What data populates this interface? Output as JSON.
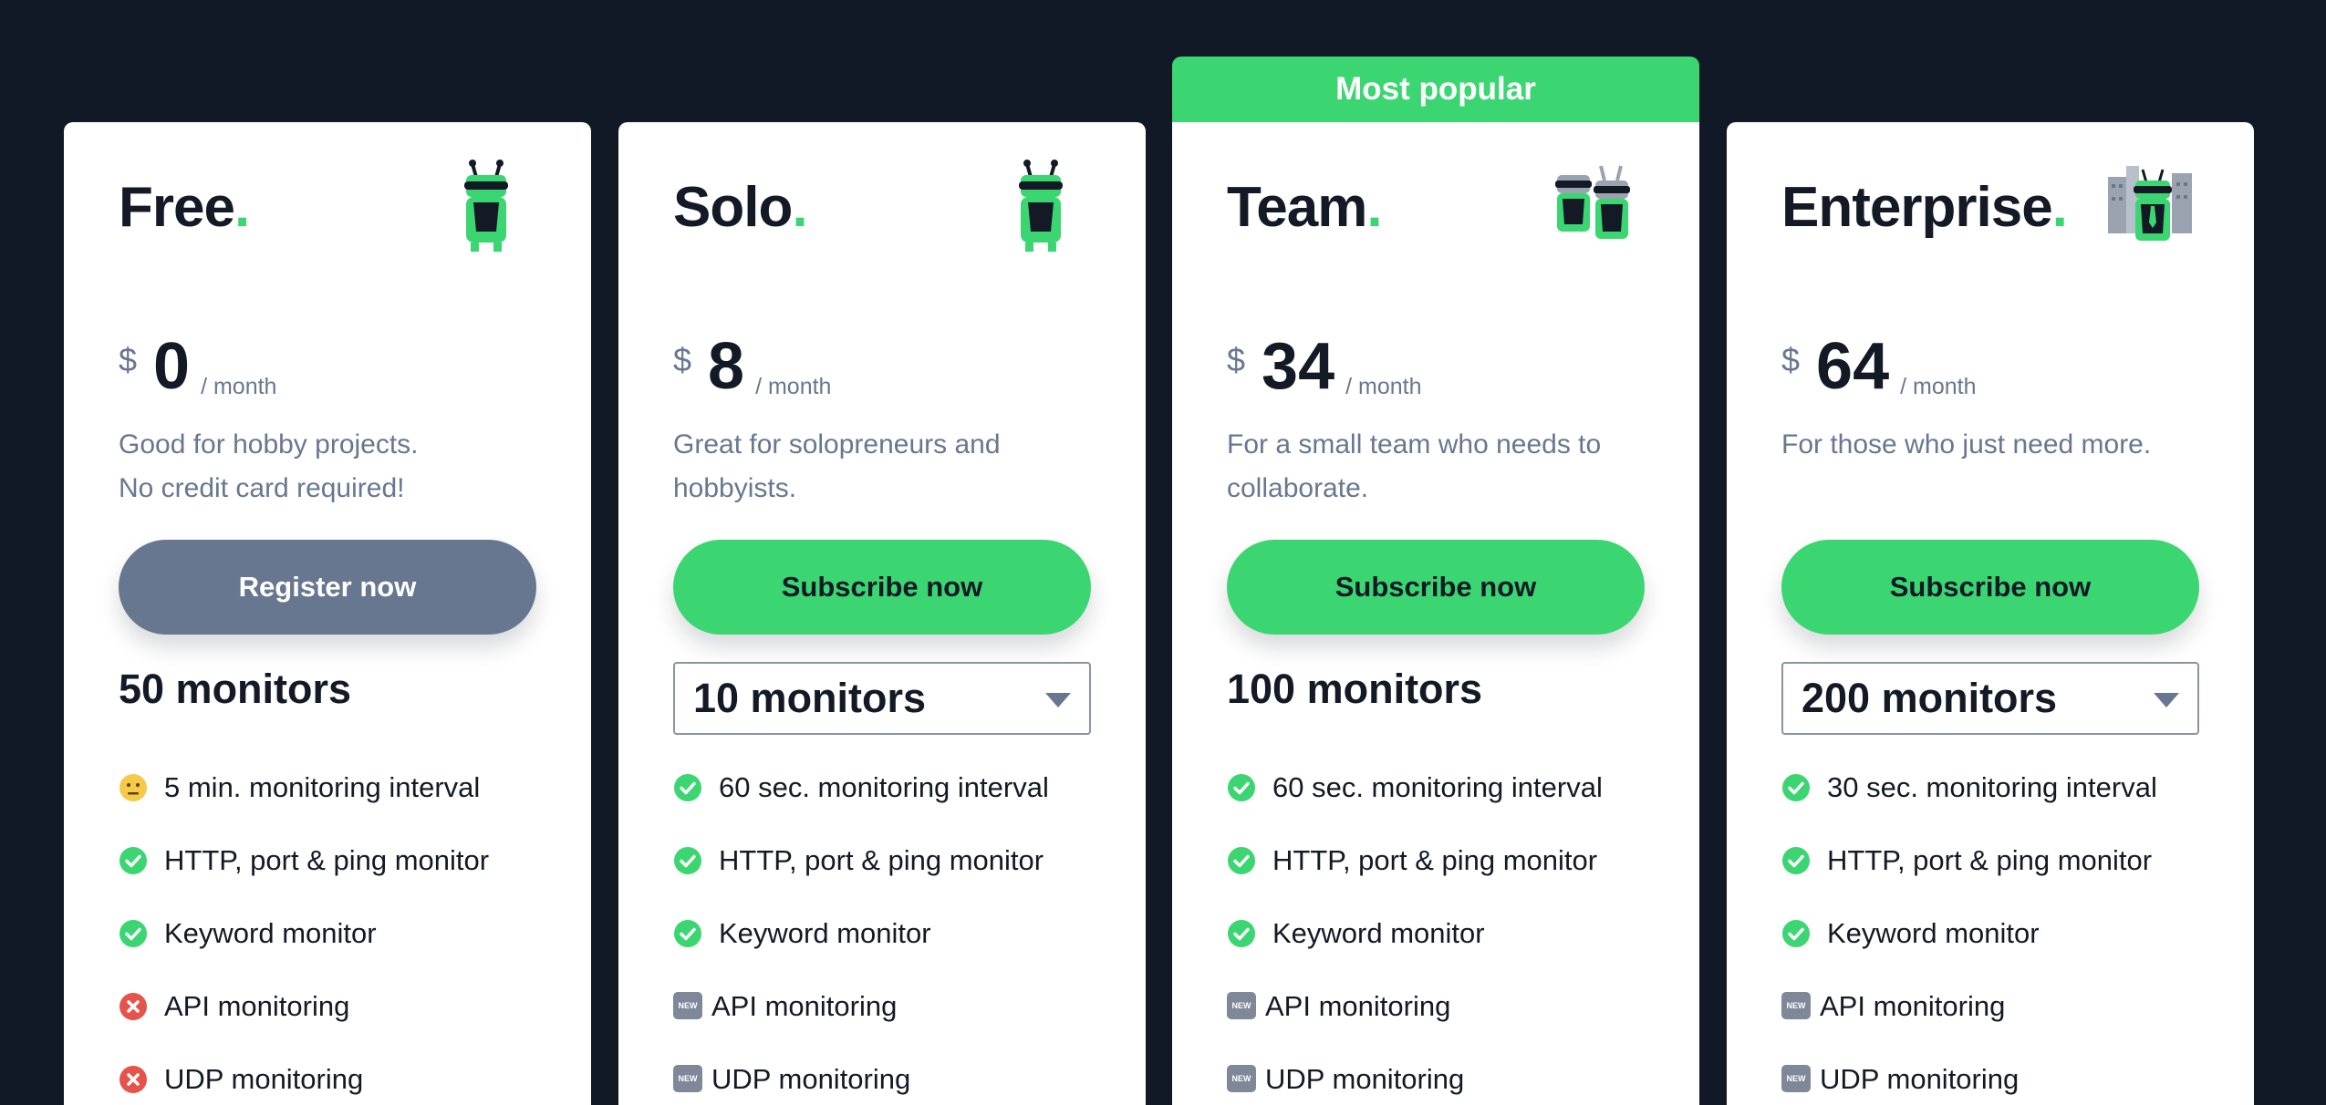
{
  "colors": {
    "background": "#121926",
    "card": "#ffffff",
    "accent_green": "#3bd671",
    "muted_grey": "#687790",
    "text_dark": "#131a26",
    "error_red": "#e5534b"
  },
  "banner": {
    "label": "Most popular"
  },
  "plans": [
    {
      "name": "Free",
      "dot": ".",
      "currency": "$",
      "price": "0",
      "period": "/ month",
      "description_lines": [
        "Good for hobby projects.",
        "No credit card required!"
      ],
      "cta_label": "Register now",
      "monitors_label": "50 monitors",
      "features": [
        {
          "icon": "neutral-face-icon",
          "text": "5 min. monitoring interval"
        },
        {
          "icon": "check-icon",
          "text": "HTTP, port & ping monitor"
        },
        {
          "icon": "check-icon",
          "text": "Keyword monitor"
        },
        {
          "icon": "cross-icon",
          "text": "API monitoring"
        },
        {
          "icon": "cross-icon",
          "text": "UDP monitoring"
        }
      ]
    },
    {
      "name": "Solo",
      "dot": ".",
      "currency": "$",
      "price": "8",
      "period": "/ month",
      "description_lines": [
        "Great for solopreneurs and",
        "hobbyists."
      ],
      "cta_label": "Subscribe now",
      "monitors_label": "10 monitors",
      "features": [
        {
          "icon": "check-icon",
          "text": "60 sec. monitoring interval"
        },
        {
          "icon": "check-icon",
          "text": "HTTP, port & ping monitor"
        },
        {
          "icon": "check-icon",
          "text": "Keyword monitor"
        },
        {
          "icon": "new-badge-icon",
          "text": "API monitoring"
        },
        {
          "icon": "new-badge-icon",
          "text": "UDP monitoring"
        }
      ]
    },
    {
      "name": "Team",
      "dot": ".",
      "currency": "$",
      "price": "34",
      "period": "/ month",
      "description_lines": [
        "For a small team who needs to",
        "collaborate."
      ],
      "cta_label": "Subscribe now",
      "monitors_label": "100 monitors",
      "features": [
        {
          "icon": "check-icon",
          "text": "60 sec. monitoring interval"
        },
        {
          "icon": "check-icon",
          "text": "HTTP, port & ping monitor"
        },
        {
          "icon": "check-icon",
          "text": "Keyword monitor"
        },
        {
          "icon": "new-badge-icon",
          "text": "API monitoring"
        },
        {
          "icon": "new-badge-icon",
          "text": "UDP monitoring"
        }
      ]
    },
    {
      "name": "Enterprise",
      "dot": ".",
      "currency": "$",
      "price": "64",
      "period": "/ month",
      "description_lines": [
        "For those who just need more."
      ],
      "cta_label": "Subscribe now",
      "monitors_label": "200 monitors",
      "features": [
        {
          "icon": "check-icon",
          "text": "30 sec. monitoring interval"
        },
        {
          "icon": "check-icon",
          "text": "HTTP, port & ping monitor"
        },
        {
          "icon": "check-icon",
          "text": "Keyword monitor"
        },
        {
          "icon": "new-badge-icon",
          "text": "API monitoring"
        },
        {
          "icon": "new-badge-icon",
          "text": "UDP monitoring"
        }
      ]
    }
  ],
  "new_badge_text": "NEW"
}
